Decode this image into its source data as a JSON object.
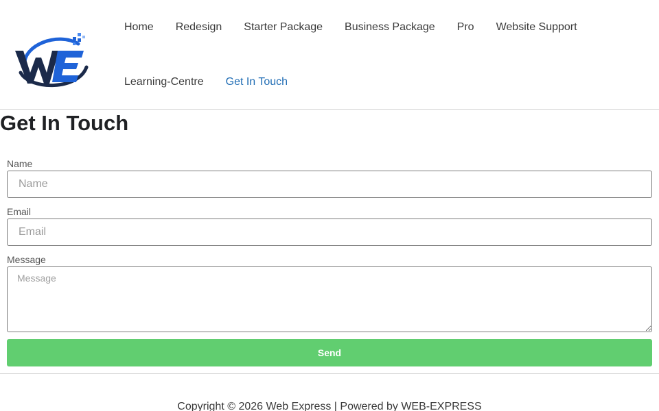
{
  "header": {
    "logo": {
      "text": "WE",
      "icon": "web-express-logo"
    },
    "nav": [
      {
        "label": "Home",
        "active": false
      },
      {
        "label": "Redesign",
        "active": false
      },
      {
        "label": "Starter Package",
        "active": false
      },
      {
        "label": "Business Package",
        "active": false
      },
      {
        "label": "Pro",
        "active": false
      },
      {
        "label": "Website Support",
        "active": false
      },
      {
        "label": "Learning-Centre",
        "active": false
      },
      {
        "label": "Get In Touch",
        "active": true
      }
    ]
  },
  "main": {
    "title": "Get In Touch",
    "form": {
      "name": {
        "label": "Name",
        "placeholder": "Name",
        "value": ""
      },
      "email": {
        "label": "Email",
        "placeholder": "Email",
        "value": ""
      },
      "message": {
        "label": "Message",
        "placeholder": "Message",
        "value": ""
      },
      "submit_label": "Send"
    }
  },
  "footer": {
    "copyright": "Copyright © 2026 Web Express | Powered by WEB-EXPRESS"
  },
  "colors": {
    "accent": "#61ce70",
    "link_active": "#1f6cb4",
    "logo_navy": "#1b2a4a",
    "logo_blue": "#1f63d8"
  }
}
